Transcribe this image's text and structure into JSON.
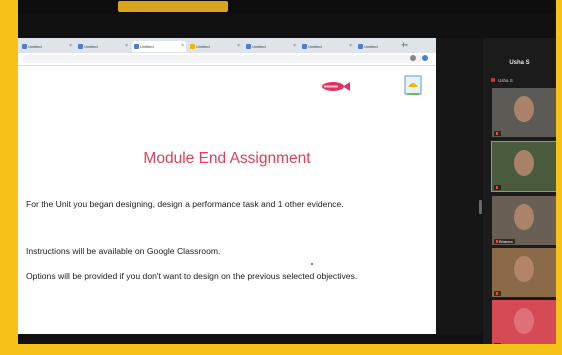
{
  "browser": {
    "tabs": [
      {
        "label": "Untitled",
        "fav": "#4a7fd4"
      },
      {
        "label": "Untitled",
        "fav": "#4a7fd4"
      },
      {
        "label": "Untitled",
        "fav": "#4a7fd4"
      },
      {
        "label": "Untitled",
        "fav": "#f4b400"
      },
      {
        "label": "Untitled",
        "fav": "#4a7fd4"
      },
      {
        "label": "Untitled",
        "fav": "#4a7fd4"
      },
      {
        "label": "Untitled",
        "fav": "#4a7fd4"
      }
    ],
    "active_tab_index": 2,
    "url": ""
  },
  "slide": {
    "title": "Module End Assignment",
    "bullets": [
      "For the Unit you began designing, design a performance task and 1 other evidence.",
      "Instructions will be available on Google Classroom.",
      "Options will be provided if you don't want to design on the previous selected objectives."
    ],
    "logo_text": "",
    "colors": {
      "title": "#e0405a",
      "logo": "#e0335f"
    }
  },
  "participants": {
    "title": "Usha S",
    "subname": "Usha S",
    "tiles": [
      {
        "name": "",
        "bg": "#5b5a55"
      },
      {
        "name": "",
        "bg": "#4a5a3c"
      },
      {
        "name": "Bhavna",
        "bg": "#6a5f55"
      },
      {
        "name": "",
        "bg": "#8a6a48"
      },
      {
        "name": "",
        "bg": "#d54a55"
      }
    ]
  }
}
